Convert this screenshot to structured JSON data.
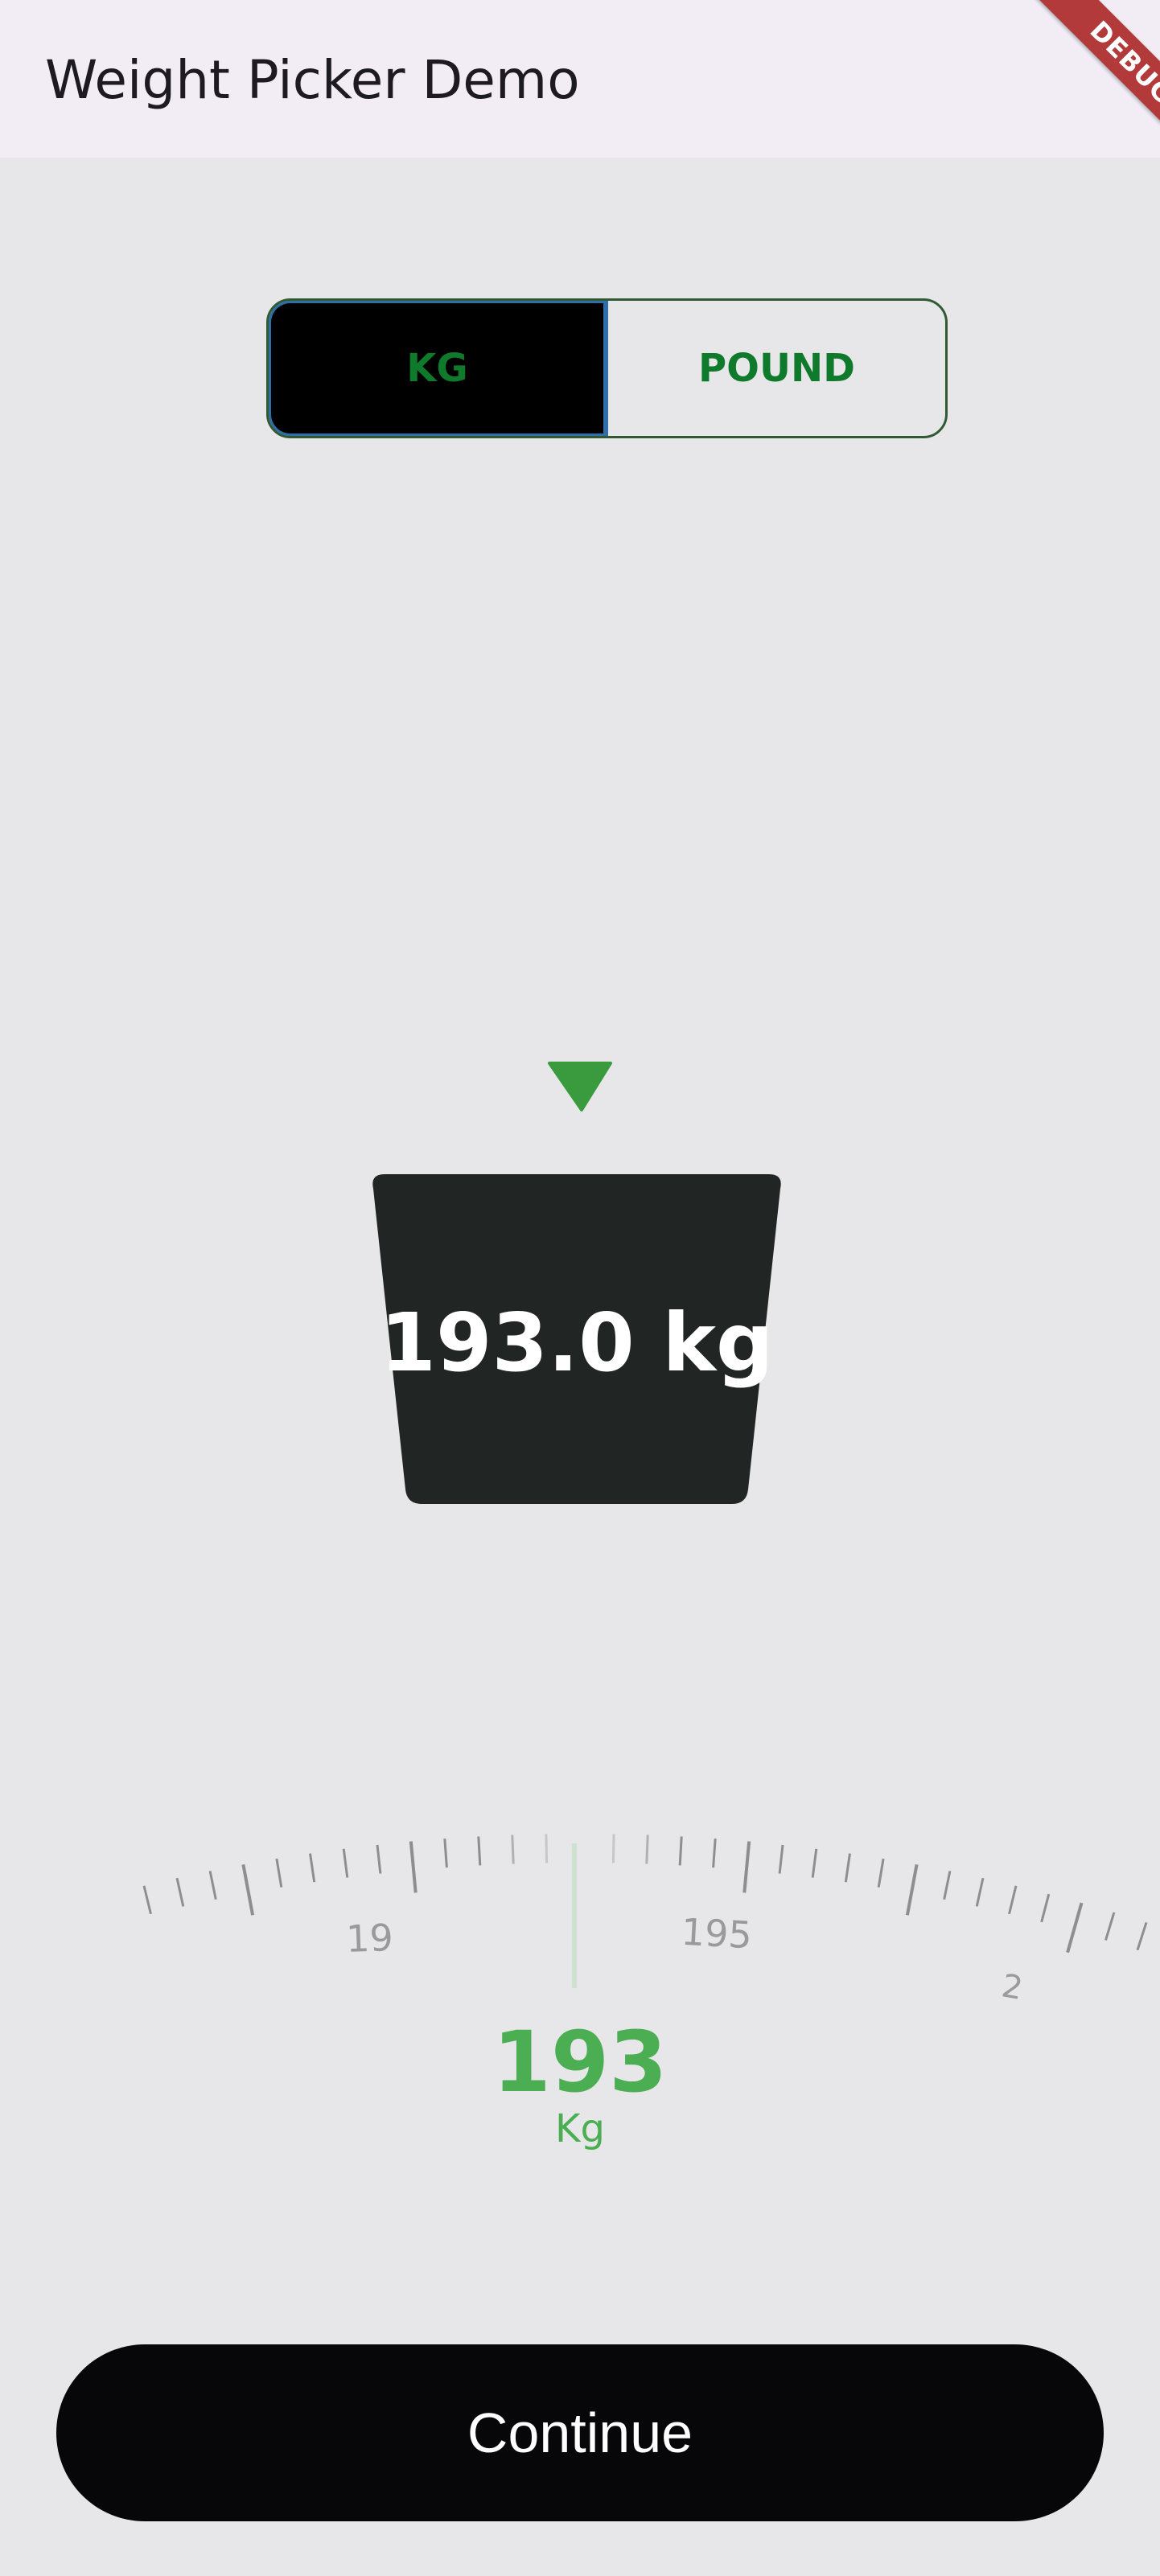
{
  "app_bar": {
    "title": "Weight Picker Demo",
    "debug_label": "DEBUG"
  },
  "unit_toggle": {
    "options": [
      {
        "label": "KG",
        "selected": true
      },
      {
        "label": "POUND",
        "selected": false
      }
    ]
  },
  "weight_display": {
    "text": "193.0 kg"
  },
  "dial": {
    "labels": [
      "19",
      "195",
      "2"
    ],
    "value": "193",
    "unit": "Kg"
  },
  "continue_button": {
    "label": "Continue"
  },
  "colors": {
    "accent_green": "#4cae52",
    "toggle_text_green": "#0f7a2b",
    "display_bg": "#212523",
    "background": "#e7e7ea",
    "appbar_bg": "#f2edf5",
    "button_bg": "#07070a",
    "debug_ribbon": "#b33a3a"
  }
}
